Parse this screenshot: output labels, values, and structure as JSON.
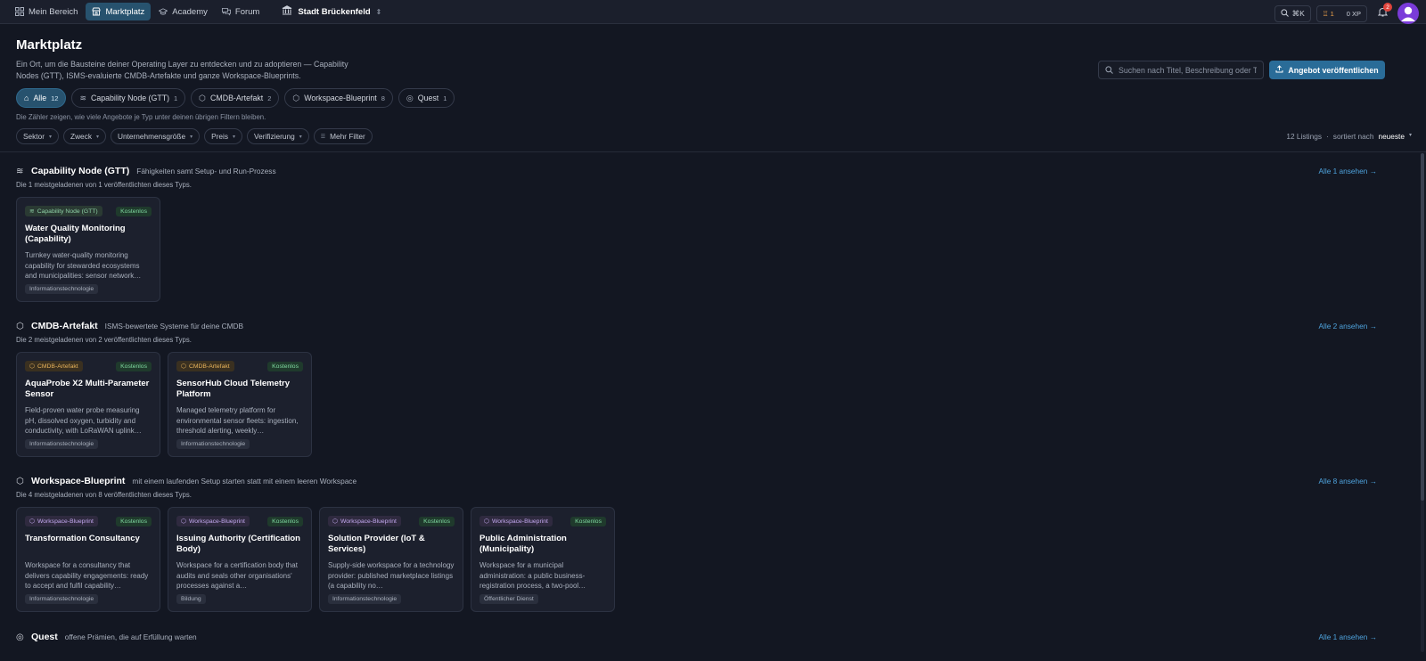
{
  "nav": {
    "items": [
      {
        "label": "Mein Bereich",
        "icon": "grid-icon"
      },
      {
        "label": "Marktplatz",
        "icon": "store-icon"
      },
      {
        "label": "Academy",
        "icon": "graduation-cap-icon"
      },
      {
        "label": "Forum",
        "icon": "chat-icon"
      }
    ],
    "org": "Stadt Brückenfeld",
    "search_shortcut": "⌘K",
    "level": "1",
    "xp": "0 XP",
    "notifications": "2"
  },
  "header": {
    "title": "Marktplatz",
    "description": "Ein Ort, um die Bausteine deiner Operating Layer zu entdecken und zu adoptieren — Capability Nodes (GTT), ISMS-evaluierte CMDB-Artefakte und ganze Workspace-Blueprints.",
    "search_placeholder": "Suchen nach Titel, Beschreibung oder Tag",
    "publish_label": "Angebot veröffentlichen"
  },
  "type_chips": [
    {
      "label": "Alle",
      "count": "12"
    },
    {
      "label": "Capability Node (GTT)",
      "count": "1"
    },
    {
      "label": "CMDB-Artefakt",
      "count": "2"
    },
    {
      "label": "Workspace-Blueprint",
      "count": "8"
    },
    {
      "label": "Quest",
      "count": "1"
    }
  ],
  "chip_hint": "Die Zähler zeigen, wie viele Angebote je Typ unter deinen übrigen Filtern bleiben.",
  "filters": [
    "Sektor",
    "Zweck",
    "Unternehmensgröße",
    "Preis",
    "Verifizierung",
    "Mehr Filter"
  ],
  "sort": {
    "count": "12 Listings",
    "label": "sortiert nach",
    "value": "neueste"
  },
  "sections": [
    {
      "title": "Capability Node (GTT)",
      "subtitle": "Fähigkeiten samt Setup- und Run-Prozess",
      "meta": "Die 1 meistgeladenen von 1 veröffentlichten dieses Typs.",
      "link": "Alle 1 ansehen →",
      "cards": [
        {
          "badge": "Capability Node (GTT)",
          "price": "Kostenlos",
          "title": "Water Quality Monitoring (Capability)",
          "desc": "Turnkey water-quality monitoring capability for stewarded ecosystems and municipalities: sensor network…",
          "tag": "Informationstechnologie"
        }
      ]
    },
    {
      "title": "CMDB-Artefakt",
      "subtitle": "ISMS-bewertete Systeme für deine CMDB",
      "meta": "Die 2 meistgeladenen von 2 veröffentlichten dieses Typs.",
      "link": "Alle 2 ansehen →",
      "cards": [
        {
          "badge": "CMDB-Artefakt",
          "price": "Kostenlos",
          "title": "AquaProbe X2 Multi-Parameter Sensor",
          "desc": "Field-proven water probe measuring pH, dissolved oxygen, turbidity and conductivity, with LoRaWAN uplink…",
          "tag": "Informationstechnologie"
        },
        {
          "badge": "CMDB-Artefakt",
          "price": "Kostenlos",
          "title": "SensorHub Cloud Telemetry Platform",
          "desc": "Managed telemetry platform for environmental sensor fleets: ingestion, threshold alerting, weekly…",
          "tag": "Informationstechnologie"
        }
      ]
    },
    {
      "title": "Workspace-Blueprint",
      "subtitle": "mit einem laufenden Setup starten statt mit einem leeren Workspace",
      "meta": "Die 4 meistgeladenen von 8 veröffentlichten dieses Typs.",
      "link": "Alle 8 ansehen →",
      "cards": [
        {
          "badge": "Workspace-Blueprint",
          "price": "Kostenlos",
          "title": "Transformation Consultancy",
          "desc": "Workspace for a consultancy that delivers capability engagements: ready to accept and fulfil capability…",
          "tag": "Informationstechnologie"
        },
        {
          "badge": "Workspace-Blueprint",
          "price": "Kostenlos",
          "title": "Issuing Authority (Certification Body)",
          "desc": "Workspace for a certification body that audits and seals other organisations' processes against a…",
          "tag": "Bildung"
        },
        {
          "badge": "Workspace-Blueprint",
          "price": "Kostenlos",
          "title": "Solution Provider (IoT & Services)",
          "desc": "Supply-side workspace for a technology provider: published marketplace listings (a capability no…",
          "tag": "Informationstechnologie"
        },
        {
          "badge": "Workspace-Blueprint",
          "price": "Kostenlos",
          "title": "Public Administration (Municipality)",
          "desc": "Workspace for a municipal administration: a public business-registration process, a two-pool…",
          "tag": "Öffentlicher Dienst"
        }
      ]
    },
    {
      "title": "Quest",
      "subtitle": "offene Prämien, die auf Erfüllung warten",
      "link": "Alle 1 ansehen →"
    }
  ]
}
